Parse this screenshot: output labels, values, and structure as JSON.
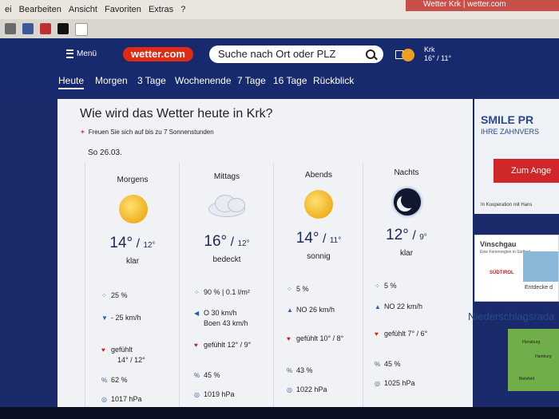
{
  "menu": [
    "ei",
    "Bearbeiten",
    "Ansicht",
    "Favoriten",
    "Extras",
    "?"
  ],
  "browser_tab": "Wetter Krk | wetter.com",
  "header": {
    "menu_label": "Menü",
    "logo": "wetter.com",
    "search_placeholder": "Suche nach Ort oder PLZ",
    "city": "Krk",
    "city_temp": "16° / 11°"
  },
  "nav": [
    "Heute",
    "Morgen",
    "3 Tage",
    "Wochenende",
    "7 Tage",
    "16 Tage",
    "Rückblick"
  ],
  "main": {
    "title": "Wie wird das Wetter heute in Krk?",
    "sun_note": "Freuen Sie sich auf bis zu 7 Sonnenstunden",
    "date": "So 26.03."
  },
  "periods": [
    {
      "name": "Morgens",
      "icon": "sun-icon",
      "hi": "14°",
      "lo": "12°",
      "cond": "klar",
      "precip": "25 %",
      "wind": "- 25 km/h",
      "wind2": "",
      "feels": "gefühlt",
      "feels2": "14° / 12°",
      "humidity": "62 %",
      "pressure": "1017 hPa"
    },
    {
      "name": "Mittags",
      "icon": "cloud-icon",
      "hi": "16°",
      "lo": "12°",
      "cond": "bedeckt",
      "precip": "90 % | 0.1 l/m²",
      "wind": "O 30 km/h",
      "wind2": "Boen 43 km/h",
      "feels": "gefühlt 12° / 9°",
      "feels2": "",
      "humidity": "45 %",
      "pressure": "1019 hPa"
    },
    {
      "name": "Abends",
      "icon": "sun-icon",
      "hi": "14°",
      "lo": "11°",
      "cond": "sonnig",
      "precip": "5 %",
      "wind": "NO 26 km/h",
      "wind2": "",
      "feels": "gefühlt 10° / 8°",
      "feels2": "",
      "humidity": "43 %",
      "pressure": "1022 hPa"
    },
    {
      "name": "Nachts",
      "icon": "moon-icon",
      "hi": "12°",
      "lo": "9°",
      "cond": "klar",
      "precip": "5 %",
      "wind": "NO 22 km/h",
      "wind2": "",
      "feels": "gefühlt 7° / 6°",
      "feels2": "",
      "humidity": "45 %",
      "pressure": "1025 hPa"
    }
  ],
  "sidebar": {
    "ad_title": "SMILE PR",
    "ad_sub": "IHRE ZAHNVERS",
    "ad_button": "Zum Ange",
    "ad_coop": "In Kooperation mit  Hans",
    "ad2_title": "Vinschgau",
    "ad2_small": "Eine Ferienregion in Südtirol",
    "ad2_logo": "SÜDTIROL",
    "ad2_cta": "Entdecke d",
    "radar_title": "Niederschlagsrada",
    "map_labels": [
      "Flensburg",
      "Hamburg",
      "Bielefeld"
    ]
  }
}
